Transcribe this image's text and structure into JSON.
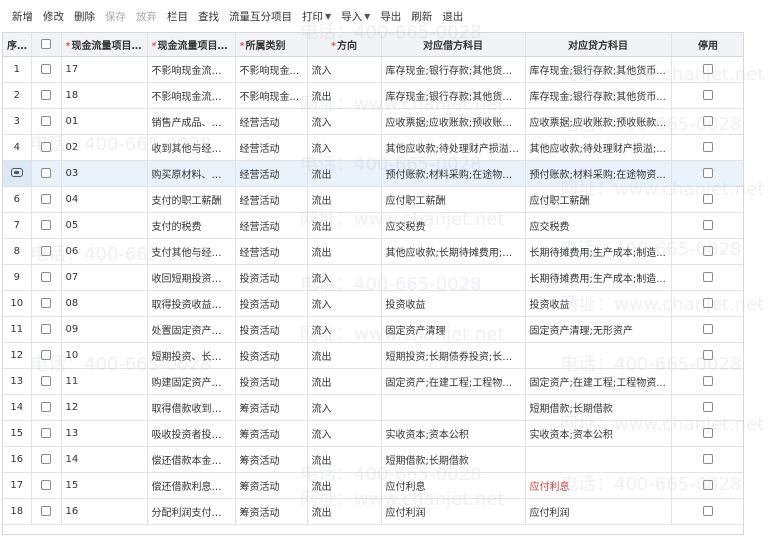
{
  "toolbar": {
    "buttons": [
      {
        "label": "新增",
        "disabled": false
      },
      {
        "label": "修改",
        "disabled": false
      },
      {
        "label": "删除",
        "disabled": false
      },
      {
        "label": "保存",
        "disabled": true
      },
      {
        "label": "放弃",
        "disabled": true
      },
      {
        "label": "栏目",
        "disabled": false
      },
      {
        "label": "查找",
        "disabled": false
      },
      {
        "label": "流量互分项目",
        "disabled": false
      },
      {
        "label": "打印",
        "disabled": false,
        "dropdown": true
      },
      {
        "label": "导入",
        "disabled": false,
        "dropdown": true
      },
      {
        "label": "导出",
        "disabled": false
      },
      {
        "label": "刷新",
        "disabled": false
      },
      {
        "label": "退出",
        "disabled": false
      }
    ]
  },
  "table": {
    "headers": {
      "seq": "序号",
      "code": "现金流量项目编码",
      "name": "现金流量项目名称",
      "category": "所属类别",
      "direction": "方向",
      "debit": "对应借方科目",
      "credit": "对应贷方科目",
      "disabled": "停用"
    },
    "rows": [
      {
        "seq": "1",
        "code": "17",
        "name": "不影响现金流量...",
        "category": "不影响现金...",
        "direction": "流入",
        "debit": "库存现金;银行存款;其他货币...",
        "credit": "库存现金;银行存款;其他货币..."
      },
      {
        "seq": "2",
        "code": "18",
        "name": "不影响现金流量...",
        "category": "不影响现金...",
        "direction": "流出",
        "debit": "库存现金;银行存款;其他货币...",
        "credit": "库存现金;银行存款;其他货币..."
      },
      {
        "seq": "3",
        "code": "01",
        "name": "销售产成品、商...",
        "category": "经营活动",
        "direction": "流入",
        "debit": "应收票据;应收账款;预收账款;...",
        "credit": "应收票据;应收账款;预收账款;..."
      },
      {
        "seq": "4",
        "code": "02",
        "name": "收到其他与经营...",
        "category": "经营活动",
        "direction": "流入",
        "debit": "其他应收款;待处理财产损溢;...",
        "credit": "其他应收款;待处理财产损溢;..."
      },
      {
        "seq": "",
        "code": "03",
        "name": "购买原材料、商...",
        "category": "经营活动",
        "direction": "流出",
        "debit": "预付账款;材料采购;在途物资...",
        "credit": "预付账款;材料采购;在途物资...",
        "selected": true
      },
      {
        "seq": "6",
        "code": "04",
        "name": "支付的职工薪酬",
        "category": "经营活动",
        "direction": "流出",
        "debit": "应付职工薪酬",
        "credit": "应付职工薪酬"
      },
      {
        "seq": "7",
        "code": "05",
        "name": "支付的税费",
        "category": "经营活动",
        "direction": "流出",
        "debit": "应交税费",
        "credit": "应交税费"
      },
      {
        "seq": "8",
        "code": "06",
        "name": "支付其他与经营...",
        "category": "经营活动",
        "direction": "流出",
        "debit": "其他应收款;长期待摊费用;待...",
        "credit": "长期待摊费用;生产成本;制造..."
      },
      {
        "seq": "9",
        "code": "07",
        "name": "收回短期投资、...",
        "category": "投资活动",
        "direction": "流入",
        "debit": "",
        "credit": "长期待摊费用;生产成本;制造..."
      },
      {
        "seq": "10",
        "code": "08",
        "name": "取得投资收益收...",
        "category": "投资活动",
        "direction": "流入",
        "debit": "投资收益",
        "credit": "投资收益"
      },
      {
        "seq": "11",
        "code": "09",
        "name": "处置固定资产、...",
        "category": "投资活动",
        "direction": "流入",
        "debit": "固定资产清理",
        "credit": "固定资产清理;无形资产"
      },
      {
        "seq": "12",
        "code": "10",
        "name": "短期投资、长期...",
        "category": "投资活动",
        "direction": "流出",
        "debit": "短期投资;长期债券投资;长期...",
        "credit": ""
      },
      {
        "seq": "13",
        "code": "11",
        "name": "购建固定资产、...",
        "category": "投资活动",
        "direction": "流出",
        "debit": "固定资产;在建工程;工程物资...",
        "credit": "固定资产;在建工程;工程物资..."
      },
      {
        "seq": "14",
        "code": "12",
        "name": "取得借款收到的...",
        "category": "筹资活动",
        "direction": "流入",
        "debit": "",
        "credit": "短期借款;长期借款"
      },
      {
        "seq": "15",
        "code": "13",
        "name": "吸收投资者投资...",
        "category": "筹资活动",
        "direction": "流入",
        "debit": "实收资本;资本公积",
        "credit": "实收资本;资本公积"
      },
      {
        "seq": "16",
        "code": "14",
        "name": "偿还借款本金支...",
        "category": "筹资活动",
        "direction": "流出",
        "debit": "短期借款;长期借款",
        "credit": ""
      },
      {
        "seq": "17",
        "code": "15",
        "name": "偿还借款利息支...",
        "category": "筹资活动",
        "direction": "流出",
        "debit": "应付利息",
        "credit": "应付利息",
        "credit_red": true
      },
      {
        "seq": "18",
        "code": "16",
        "name": "分配利润支付的...",
        "category": "筹资活动",
        "direction": "流出",
        "debit": "应付利润",
        "credit": "应付利润"
      }
    ]
  },
  "watermarks": {
    "phone": "电话：400-665-0028",
    "site": "网址：www.chanjet.net"
  },
  "colors": {
    "header_bg": "#f1f3f6",
    "selected_row": "#eaf2fc",
    "required_mark": "#e02020"
  }
}
